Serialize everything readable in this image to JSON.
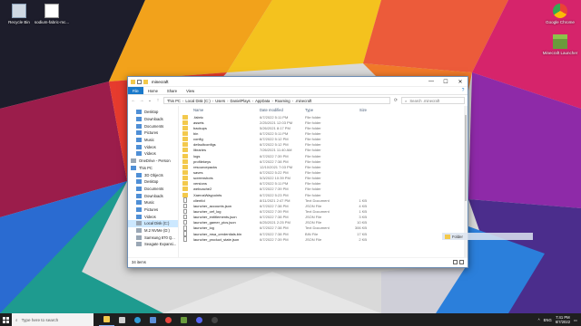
{
  "desktop": {
    "icons": [
      {
        "label": "Recycle Bin",
        "icon": "recycle-bin-icon"
      },
      {
        "label": "sodium-fabric-mc...",
        "icon": "file-icon"
      },
      {
        "label": "Google Chrome",
        "icon": "chrome-icon"
      },
      {
        "label": "Minecraft Launcher",
        "icon": "minecraft-icon"
      }
    ]
  },
  "window": {
    "title": "minecraft",
    "controls": {
      "minimize": "—",
      "maximize": "☐",
      "close": "✕"
    },
    "ribbon_tabs": [
      "File",
      "Home",
      "Share",
      "View"
    ],
    "help": "?",
    "nav": {
      "back": "←",
      "forward": "→",
      "up": "↑",
      "recent": "⌄",
      "refresh": "⟳"
    },
    "breadcrumb": [
      "This PC",
      "Local Disk (C:)",
      "Users",
      "DanielPlays",
      "AppData",
      "Roaming",
      ".minecraft"
    ],
    "search_placeholder": "Search .minecraft",
    "sidebar": [
      {
        "label": "Desktop",
        "icon": "desktop-icon",
        "indent": 1
      },
      {
        "label": "Downloads",
        "icon": "downloads-icon",
        "indent": 1
      },
      {
        "label": "Documents",
        "icon": "documents-icon",
        "indent": 1
      },
      {
        "label": "Pictures",
        "icon": "pictures-icon",
        "indent": 1
      },
      {
        "label": "Music",
        "icon": "music-icon",
        "indent": 1
      },
      {
        "label": "Videos",
        "icon": "videos-icon",
        "indent": 1
      },
      {
        "label": "Videos",
        "icon": "videos-icon",
        "indent": 1
      },
      {
        "label": "OneDrive - Person",
        "icon": "onedrive-icon",
        "indent": 0
      },
      {
        "label": "This PC",
        "icon": "pc-icon",
        "indent": 0
      },
      {
        "label": "3D Objects",
        "icon": "objects-icon",
        "indent": 1
      },
      {
        "label": "Desktop",
        "icon": "desktop-icon",
        "indent": 1
      },
      {
        "label": "Documents",
        "icon": "documents-icon",
        "indent": 1
      },
      {
        "label": "Downloads",
        "icon": "downloads-icon",
        "indent": 1
      },
      {
        "label": "Music",
        "icon": "music-icon",
        "indent": 1
      },
      {
        "label": "Pictures",
        "icon": "pictures-icon",
        "indent": 1
      },
      {
        "label": "Videos",
        "icon": "videos-icon",
        "indent": 1
      },
      {
        "label": "Local Disk (C:)",
        "icon": "drive-icon",
        "indent": 1,
        "selected": true
      },
      {
        "label": "M.2 NVMe (D:)",
        "icon": "drive-icon",
        "indent": 1
      },
      {
        "label": "Samsung 870 Q...",
        "icon": "drive-icon",
        "indent": 1
      },
      {
        "label": "Seagate Expansi...",
        "icon": "drive-icon",
        "indent": 1
      }
    ],
    "columns": {
      "name": "Name",
      "date": "Date modified",
      "type": "Type",
      "size": "Size"
    },
    "files": [
      {
        "name": ".fabric",
        "date": "6/7/2022 5:11 PM",
        "type": "File folder",
        "size": "",
        "kind": "folder"
      },
      {
        "name": "assets",
        "date": "2/25/2021 12:03 PM",
        "type": "File folder",
        "size": "",
        "kind": "folder"
      },
      {
        "name": "backups",
        "date": "5/26/2021 8:17 PM",
        "type": "File folder",
        "size": "",
        "kind": "folder"
      },
      {
        "name": "bin",
        "date": "6/7/2022 5:11 PM",
        "type": "File folder",
        "size": "",
        "kind": "folder"
      },
      {
        "name": "config",
        "date": "6/7/2022 5:12 PM",
        "type": "File folder",
        "size": "",
        "kind": "folder"
      },
      {
        "name": "defaultconfigs",
        "date": "6/7/2022 5:12 PM",
        "type": "File folder",
        "size": "",
        "kind": "folder"
      },
      {
        "name": "libraries",
        "date": "7/26/2021 11:40 AM",
        "type": "File folder",
        "size": "",
        "kind": "folder"
      },
      {
        "name": "logs",
        "date": "6/7/2022 7:39 PM",
        "type": "File folder",
        "size": "",
        "kind": "folder"
      },
      {
        "name": "profilekeys",
        "date": "6/7/2022 7:38 PM",
        "type": "File folder",
        "size": "",
        "kind": "folder"
      },
      {
        "name": "resourcepacks",
        "date": "12/10/2021 7:03 PM",
        "type": "File folder",
        "size": "",
        "kind": "folder"
      },
      {
        "name": "saves",
        "date": "6/7/2022 5:22 PM",
        "type": "File folder",
        "size": "",
        "kind": "folder"
      },
      {
        "name": "screenshots",
        "date": "5/3/2022 10:39 PM",
        "type": "File folder",
        "size": "",
        "kind": "folder"
      },
      {
        "name": "versions",
        "date": "6/7/2022 5:11 PM",
        "type": "File folder",
        "size": "",
        "kind": "folder"
      },
      {
        "name": "webcache2",
        "date": "6/7/2022 7:39 PM",
        "type": "File folder",
        "size": "",
        "kind": "folder"
      },
      {
        "name": "XaerosWaypoints",
        "date": "6/7/2022 5:23 PM",
        "type": "File folder",
        "size": "",
        "kind": "folder"
      },
      {
        "name": "clientId",
        "date": "8/11/2021 2:47 PM",
        "type": "Text Document",
        "size": "1 KB",
        "kind": "file"
      },
      {
        "name": "launcher_accounts.json",
        "date": "6/7/2022 7:38 PM",
        "type": "JSON File",
        "size": "4 KB",
        "kind": "file"
      },
      {
        "name": "launcher_cef_log",
        "date": "6/7/2022 7:39 PM",
        "type": "Text Document",
        "size": "1 KB",
        "kind": "file"
      },
      {
        "name": "launcher_entitlements.json",
        "date": "6/7/2022 7:38 PM",
        "type": "JSON File",
        "size": "3 KB",
        "kind": "file"
      },
      {
        "name": "launcher_gamer_pics.json",
        "date": "6/25/2021 2:25 PM",
        "type": "JSON File",
        "size": "10 KB",
        "kind": "file"
      },
      {
        "name": "launcher_log",
        "date": "6/7/2022 7:38 PM",
        "type": "Text Document",
        "size": "306 KB",
        "kind": "file"
      },
      {
        "name": "launcher_msa_credentials.bin",
        "date": "6/7/2022 7:38 PM",
        "type": "BIN File",
        "size": "17 KB",
        "kind": "file"
      },
      {
        "name": "launcher_product_state.json",
        "date": "6/7/2022 7:39 PM",
        "type": "JSON File",
        "size": "2 KB",
        "kind": "file"
      }
    ],
    "status": "34 items"
  },
  "drag_ghost": {
    "label": "Folder"
  },
  "taskbar": {
    "search_placeholder": "Type here to search",
    "apps": [
      {
        "icon": "file-explorer-icon",
        "color": "#f3c94c",
        "active": true
      },
      {
        "icon": "task-view-icon",
        "color": "#cfcfcf"
      },
      {
        "icon": "edge-icon",
        "color": "#2f9bd6"
      },
      {
        "icon": "store-icon",
        "color": "#5b8fd9"
      },
      {
        "icon": "chrome-icon",
        "color": "#e8453c"
      },
      {
        "icon": "minecraft-icon",
        "color": "#6a9b3c"
      },
      {
        "icon": "discord-icon",
        "color": "#5865f2"
      },
      {
        "icon": "obs-icon",
        "color": "#444444"
      }
    ],
    "tray": {
      "lang": "ENG",
      "time": "7:41 PM",
      "date": "6/7/2022"
    }
  }
}
